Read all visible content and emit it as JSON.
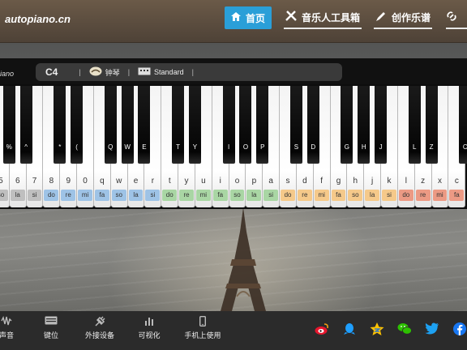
{
  "nav": {
    "logo": "autopiano.cn",
    "items": [
      {
        "label": "首页",
        "icon": "home-icon",
        "active": true
      },
      {
        "label": "音乐人工具箱",
        "icon": "tools-icon"
      },
      {
        "label": "创作乐谱",
        "icon": "pen-icon"
      },
      {
        "label": "",
        "icon": "link-icon"
      }
    ]
  },
  "piano_bar": {
    "brand_tail": "iano",
    "note": "C4",
    "instrument": "钟琴",
    "mode": "Standard",
    "sep": "|"
  },
  "black_key_labels": [
    "%",
    "^",
    "*",
    "(",
    "Q",
    "W",
    "E",
    "T",
    "Y",
    "I",
    "O",
    "P",
    "S",
    "D",
    "G",
    "H",
    "J",
    "L",
    "Z",
    "C"
  ],
  "white_keys": [
    {
      "key": "5",
      "solfege": "so",
      "color": "#bfbfbf"
    },
    {
      "key": "6",
      "solfege": "la",
      "color": "#bfbfbf"
    },
    {
      "key": "7",
      "solfege": "si",
      "color": "#bfbfbf"
    },
    {
      "key": "8",
      "solfege": "do",
      "color": "#9ec3e6"
    },
    {
      "key": "9",
      "solfege": "re",
      "color": "#9ec3e6"
    },
    {
      "key": "0",
      "solfege": "mi",
      "color": "#9ec3e6"
    },
    {
      "key": "q",
      "solfege": "fa",
      "color": "#9ec3e6"
    },
    {
      "key": "w",
      "solfege": "so",
      "color": "#9ec3e6"
    },
    {
      "key": "e",
      "solfege": "la",
      "color": "#9ec3e6"
    },
    {
      "key": "r",
      "solfege": "si",
      "color": "#9ec3e6"
    },
    {
      "key": "t",
      "solfege": "do",
      "color": "#a9d6a4"
    },
    {
      "key": "y",
      "solfege": "re",
      "color": "#a9d6a4"
    },
    {
      "key": "u",
      "solfege": "mi",
      "color": "#a9d6a4"
    },
    {
      "key": "i",
      "solfege": "fa",
      "color": "#a9d6a4"
    },
    {
      "key": "o",
      "solfege": "so",
      "color": "#a9d6a4"
    },
    {
      "key": "p",
      "solfege": "la",
      "color": "#a9d6a4"
    },
    {
      "key": "a",
      "solfege": "si",
      "color": "#a9d6a4"
    },
    {
      "key": "s",
      "solfege": "do",
      "color": "#f5c98a"
    },
    {
      "key": "d",
      "solfege": "re",
      "color": "#f5c98a"
    },
    {
      "key": "f",
      "solfege": "mi",
      "color": "#f5c98a"
    },
    {
      "key": "g",
      "solfege": "fa",
      "color": "#f5c98a"
    },
    {
      "key": "h",
      "solfege": "so",
      "color": "#f5c98a"
    },
    {
      "key": "j",
      "solfege": "la",
      "color": "#f5c98a"
    },
    {
      "key": "k",
      "solfege": "si",
      "color": "#f5c98a"
    },
    {
      "key": "l",
      "solfege": "do",
      "color": "#ec9a84"
    },
    {
      "key": "z",
      "solfege": "re",
      "color": "#ec9a84"
    },
    {
      "key": "x",
      "solfege": "mi",
      "color": "#ec9a84"
    },
    {
      "key": "c",
      "solfege": "fa",
      "color": "#ec9a84"
    }
  ],
  "bottom": {
    "items": [
      {
        "label": "声音",
        "icon": "waveform-icon"
      },
      {
        "label": "键位",
        "icon": "keyboard-icon"
      },
      {
        "label": "外接设备",
        "icon": "plug-icon"
      },
      {
        "label": "可视化",
        "icon": "bar-chart-icon"
      },
      {
        "label": "手机上使用",
        "icon": "mobile-icon"
      }
    ],
    "social": [
      {
        "icon": "weibo-icon",
        "color": "#e6162d"
      },
      {
        "icon": "qq-icon",
        "color": "#1e9fff"
      },
      {
        "icon": "qzone-icon",
        "color": "#ffc300"
      },
      {
        "icon": "wechat-icon",
        "color": "#2dc100"
      },
      {
        "icon": "twitter-icon",
        "color": "#1da1f2"
      },
      {
        "icon": "facebook-icon",
        "color": "#1877f2"
      }
    ]
  },
  "colors": {
    "nav_active": "#2a9fd8"
  }
}
